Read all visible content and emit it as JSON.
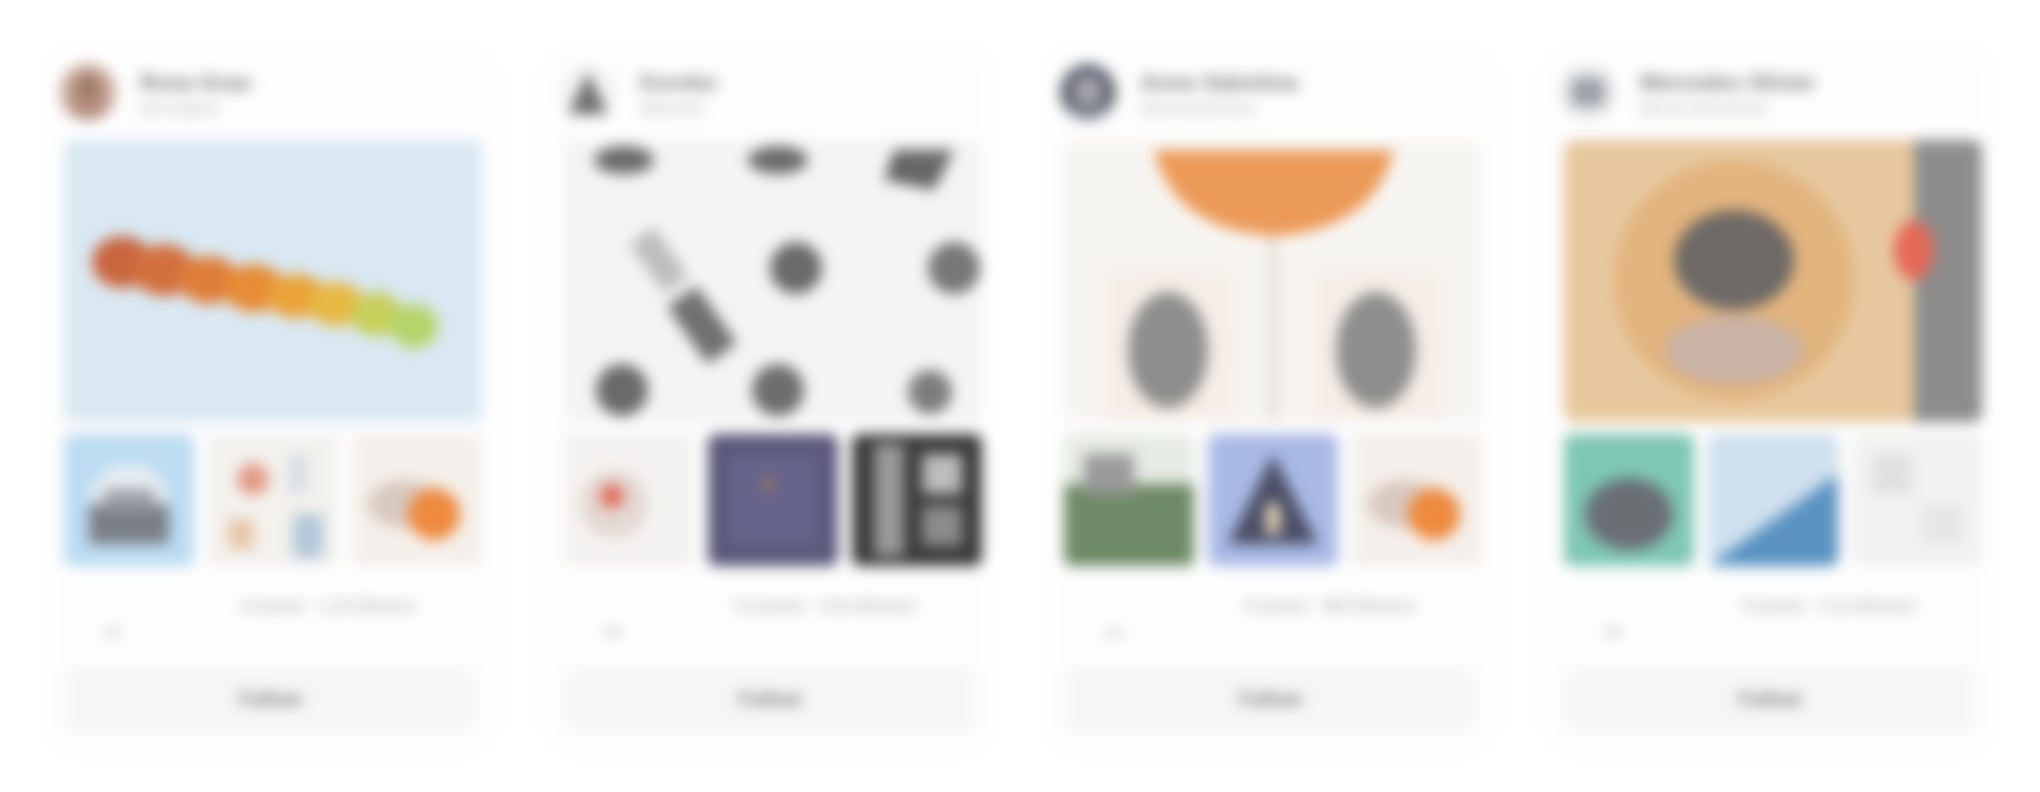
{
  "cards": [
    {
      "user_name": "Rosa Grau",
      "user_handle": "@rosagrau",
      "stats": "8 boards · 1.2k followers",
      "time": "2d",
      "follow_label": "Follow",
      "avatar_color": "#c9a89a"
    },
    {
      "user_name": "Kuroko",
      "user_handle": "@kuroko",
      "stats": "12 boards · 3.4k followers",
      "time": "5d",
      "follow_label": "Follow",
      "avatar_color": "#8a8a8a"
    },
    {
      "user_name": "Anna Valentina",
      "user_handle": "@annavalentina",
      "stats": "6 boards · 980 followers",
      "time": "1w",
      "follow_label": "Follow",
      "avatar_color": "#5f6470"
    },
    {
      "user_name": "Mercedes Olivier",
      "user_handle": "@mercedesolivier",
      "stats": "9 boards · 2.1k followers",
      "time": "3d",
      "follow_label": "Follow",
      "avatar_color": "#9aa0a6"
    }
  ]
}
